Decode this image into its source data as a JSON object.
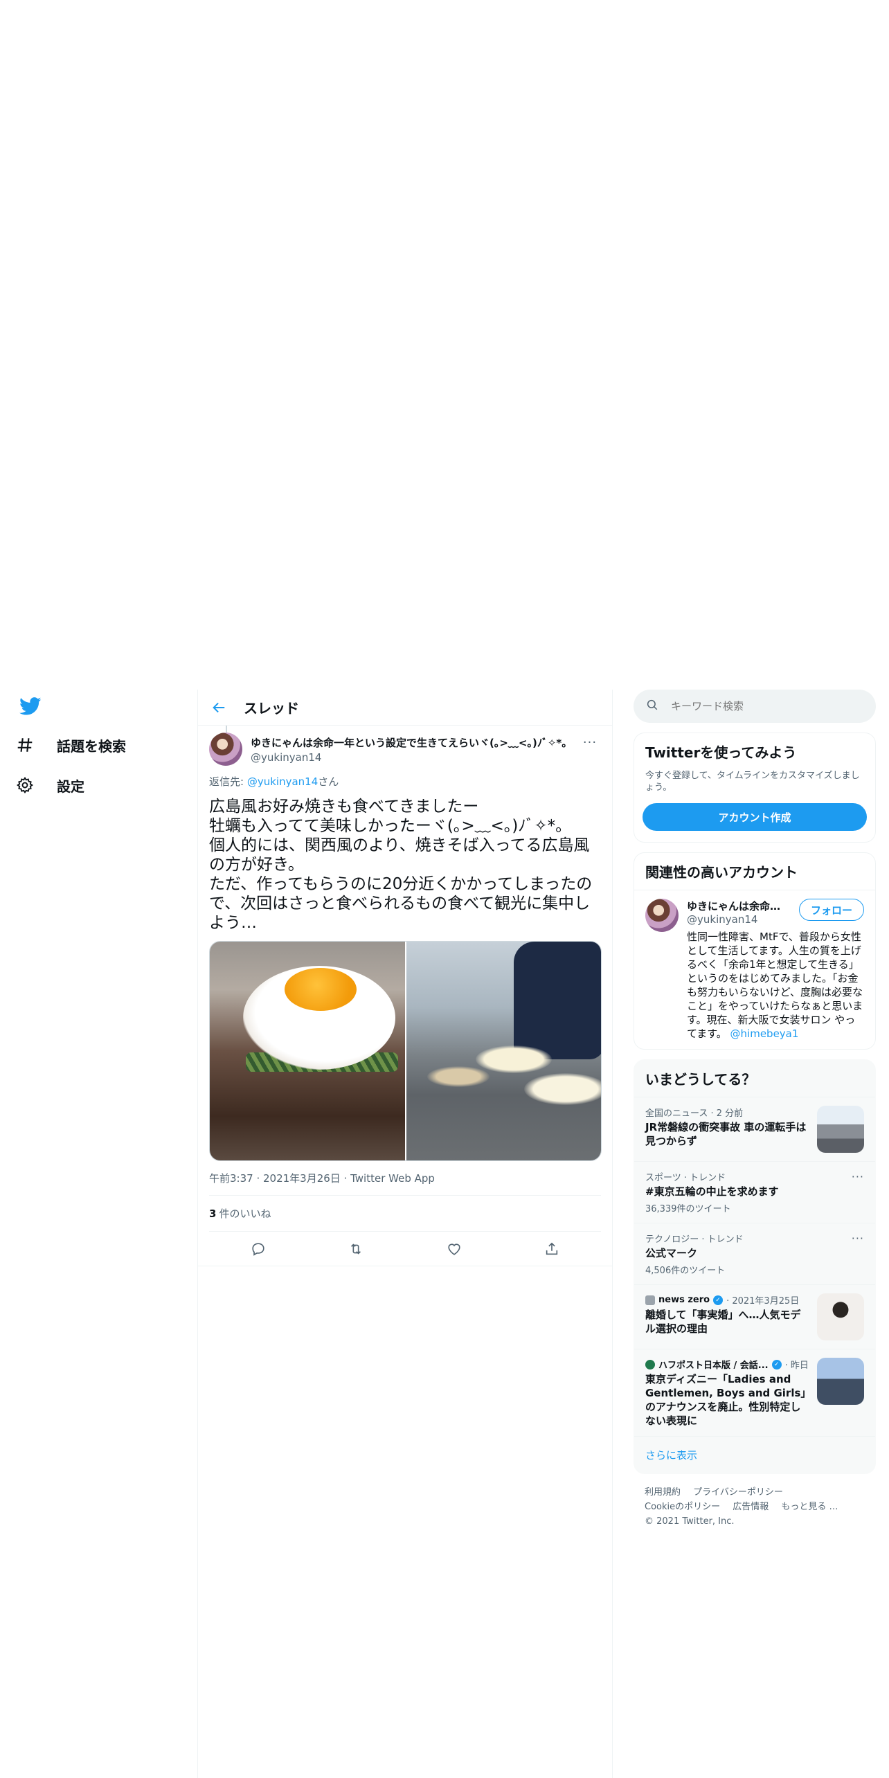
{
  "nav": {
    "explore_label": "話題を検索",
    "settings_label": "設定"
  },
  "header": {
    "title": "スレッド"
  },
  "tweet": {
    "display_name": "ゆきにゃんは余命一年という設定で生きてえらいヾ(｡>﹏<｡)ﾉﾞ✧*。",
    "handle": "@yukinyan14",
    "reply_prefix": "返信先: ",
    "reply_handle": "@yukinyan14",
    "reply_suffix": "さん",
    "text": "広島風お好み焼きも食べてきましたー\n牡蠣も入ってて美味しかったーヾ(｡>﹏<｡)ﾉﾞ✧*。\n個人的には、関西風のより、焼きそば入ってる広島風の方が好き。\nただ、作ってもらうのに20分近くかかってしまったので、次回はさっと食べられるもの食べて観光に集中しよう…",
    "meta": "午前3:37 · 2021年3月26日 · Twitter Web App",
    "likes_count": "3",
    "likes_label": "件のいいね"
  },
  "right": {
    "search_placeholder": "キーワード検索",
    "signup": {
      "title": "Twitterを使ってみよう",
      "subtitle": "今すぐ登録して、タイムラインをカスタマイズしましょう。",
      "button": "アカウント作成"
    },
    "relevant": {
      "title": "関連性の高いアカウント",
      "name": "ゆきにゃんは余命一年という設定で生きてえらい",
      "handle": "@yukinyan14",
      "follow": "フォロー",
      "bio": "性同一性障害、MtFで、普段から女性として生活してます。人生の質を上げるべく「余命1年と想定して生きる」というのをはじめてみました。「お金も努力もいらないけど、度胸は必要なこと」をやっていけたらなぁと思います。現在、新大阪で女装サロン やってます。 ",
      "bio_link": "@himebeya1"
    },
    "trends": {
      "title": "いまどうしてる？",
      "items": [
        {
          "cat": "全国のニュース · 2 分前",
          "title": "JR常磐線の衝突事故 車の運転手は見つからず"
        },
        {
          "cat": "スポーツ · トレンド",
          "title": "#東京五輪の中止を求めます",
          "count": "36,339件のツイート"
        },
        {
          "cat": "テクノロジー · トレンド",
          "title": "公式マーク",
          "count": "4,506件のツイート"
        },
        {
          "src": "news zero",
          "date": "· 2021年3月25日",
          "title": "離婚して「事実婚」へ…人気モデル選択の理由"
        },
        {
          "src": "ハフポスト日本版 / 会話...",
          "date": "· 昨日",
          "title": "東京ディズニー「Ladies and Gentlemen, Boys and Girls」のアナウンスを廃止。性別特定しない表現に"
        }
      ],
      "more": "さらに表示"
    },
    "footer": {
      "terms": "利用規約",
      "privacy": "プライバシーポリシー",
      "cookie": "Cookieのポリシー",
      "ads": "広告情報",
      "more": "もっと見る …",
      "copyright": "© 2021 Twitter, Inc."
    }
  },
  "colors": {
    "accent": "#1d9bf0",
    "text": "#0f1419",
    "secondary": "#536471"
  }
}
